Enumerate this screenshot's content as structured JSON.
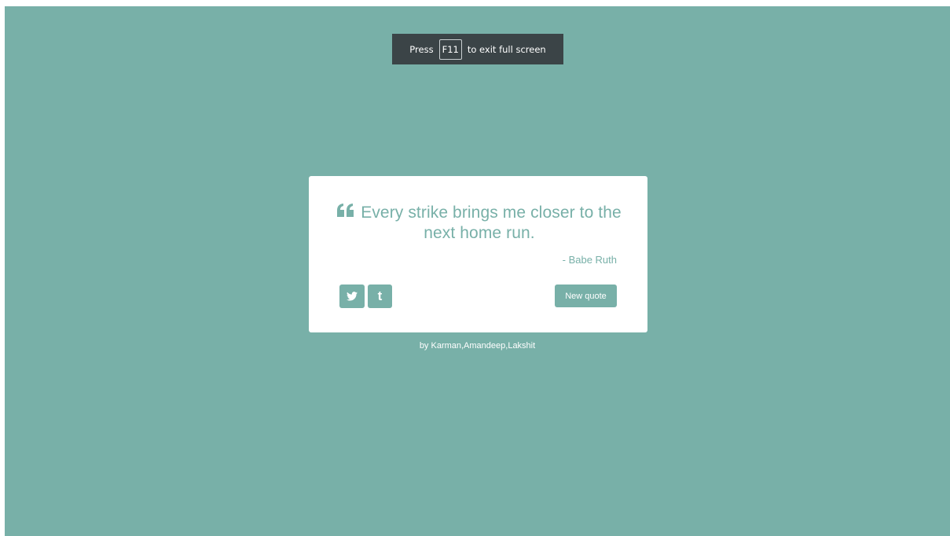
{
  "theme": {
    "background": "#78b0a8",
    "accent": "#78b0a8",
    "card": "#ffffff",
    "toast_bg": "#3b4447"
  },
  "fullscreen_notice": {
    "prefix": "Press",
    "key": "F11",
    "suffix": "to exit full screen"
  },
  "quote": {
    "icon": "quote-left-icon",
    "text": "Every strike brings me closer to the next home run.",
    "author": "- Babe Ruth"
  },
  "actions": {
    "twitter_icon": "twitter-icon",
    "tumblr_label": "t",
    "new_quote_label": "New quote"
  },
  "footer": {
    "credit": "by Karman,Amandeep,Lakshit"
  }
}
